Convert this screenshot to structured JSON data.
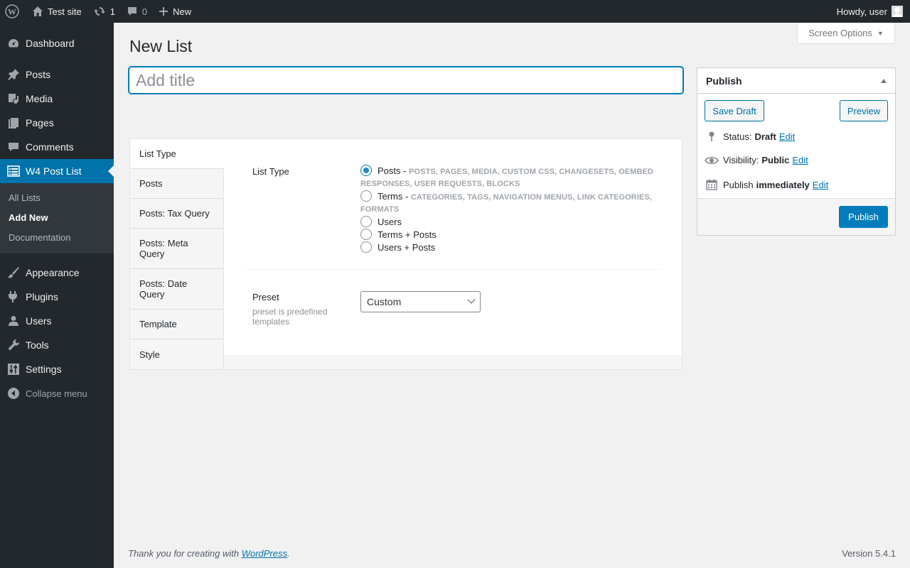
{
  "adminbar": {
    "site_name": "Test site",
    "updates_count": "1",
    "comments_count": "0",
    "new_label": "New",
    "howdy": "Howdy, user"
  },
  "sidebar": {
    "items": [
      {
        "label": "Dashboard",
        "icon": "dashboard-icon"
      },
      {
        "label": "Posts",
        "icon": "pushpin-icon"
      },
      {
        "label": "Media",
        "icon": "media-icon"
      },
      {
        "label": "Pages",
        "icon": "pages-icon"
      },
      {
        "label": "Comments",
        "icon": "comment-icon"
      },
      {
        "label": "W4 Post List",
        "icon": "list-icon"
      },
      {
        "label": "Appearance",
        "icon": "brush-icon"
      },
      {
        "label": "Plugins",
        "icon": "plug-icon"
      },
      {
        "label": "Users",
        "icon": "user-icon"
      },
      {
        "label": "Tools",
        "icon": "wrench-icon"
      },
      {
        "label": "Settings",
        "icon": "sliders-icon"
      }
    ],
    "submenu": [
      "All Lists",
      "Add New",
      "Documentation"
    ],
    "collapse": "Collapse menu"
  },
  "main": {
    "screen_options": "Screen Options",
    "page_title": "New List",
    "title_placeholder": "Add title"
  },
  "tabs": [
    "List Type",
    "Posts",
    "Posts: Tax Query",
    "Posts: Meta Query",
    "Posts: Date Query",
    "Template",
    "Style"
  ],
  "list_type": {
    "label": "List Type",
    "options": [
      {
        "label": "Posts",
        "desc": "POSTS, PAGES, MEDIA, CUSTOM CSS, CHANGESETS, OEMBED RESPONSES, USER REQUESTS, BLOCKS",
        "checked": true
      },
      {
        "label": "Terms",
        "desc": "CATEGORIES, TAGS, NAVIGATION MENUS, LINK CATEGORIES, FORMATS",
        "checked": false
      },
      {
        "label": "Users",
        "desc": "",
        "checked": false
      },
      {
        "label": "Terms + Posts",
        "desc": "",
        "checked": false
      },
      {
        "label": "Users + Posts",
        "desc": "",
        "checked": false
      }
    ],
    "separator": " - "
  },
  "preset": {
    "label": "Preset",
    "desc": "preset is predefined templates",
    "value": "Custom"
  },
  "publish": {
    "title": "Publish",
    "save_draft": "Save Draft",
    "preview": "Preview",
    "status_label": "Status:",
    "status_value": "Draft",
    "visibility_label": "Visibility:",
    "visibility_value": "Public",
    "publish_label": "Publish",
    "publish_value": "immediately",
    "edit": "Edit",
    "publish_button": "Publish"
  },
  "footer": {
    "thanks_prefix": "Thank you for creating with ",
    "thanks_link": "WordPress",
    "thanks_suffix": ".",
    "version": "Version 5.4.1"
  },
  "colors": {
    "accent": "#0073aa",
    "admin_dark": "#23282d",
    "background": "#f1f1f1"
  }
}
